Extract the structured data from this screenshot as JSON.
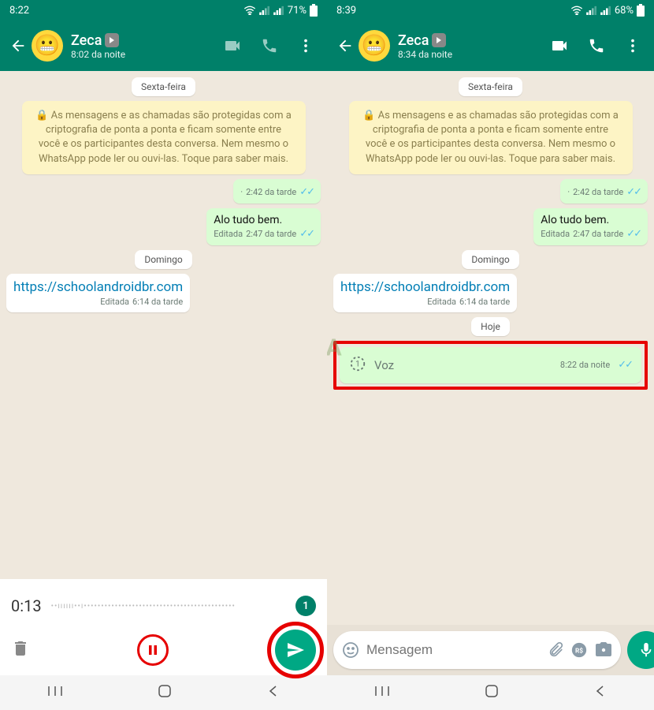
{
  "left": {
    "status_time": "8:22",
    "battery": "71%",
    "contact_name": "Zeca",
    "contact_status": "8:02 da noite",
    "chip_friday": "Sexta-feira",
    "encryption": "🔒 As mensagens e as chamadas são protegidas com a criptografia de ponta a ponta e ficam somente entre você e os participantes desta conversa. Nem mesmo o WhatsApp pode ler ou ouvi-las. Toque para saber mais.",
    "msg1_time": "2:42 da tarde",
    "msg2_text": "Alo tudo bem.",
    "msg2_edited": "Editada",
    "msg2_time": "2:47 da tarde",
    "chip_sunday": "Domingo",
    "msg3_link": "https://schoolandroidbr.com",
    "msg3_edited": "Editada",
    "msg3_time": "6:14 da tarde",
    "rec_time": "0:13",
    "rec_badge": "1"
  },
  "right": {
    "status_time": "8:39",
    "battery": "68%",
    "contact_name": "Zeca",
    "contact_status": "8:34 da noite",
    "chip_friday": "Sexta-feira",
    "encryption": "🔒 As mensagens e as chamadas são protegidas com a criptografia de ponta a ponta e ficam somente entre você e os participantes desta conversa. Nem mesmo o WhatsApp pode ler ou ouvi-las. Toque para saber mais.",
    "msg1_time": "2:42 da tarde",
    "msg2_text": "Alo tudo bem.",
    "msg2_edited": "Editada",
    "msg2_time": "2:47 da tarde",
    "chip_sunday": "Domingo",
    "msg3_link": "https://schoolandroidbr.com",
    "msg3_edited": "Editada",
    "msg3_time": "6:14 da tarde",
    "chip_today": "Hoje",
    "voice_label": "Voz",
    "voice_time": "8:22 da noite",
    "input_placeholder": "Mensagem",
    "watermark": "SA"
  }
}
